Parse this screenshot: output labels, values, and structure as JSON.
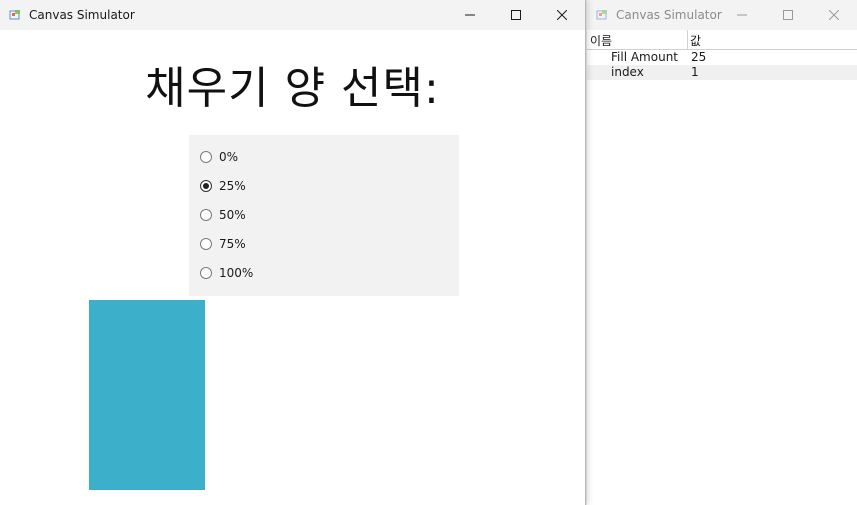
{
  "main_window": {
    "title": "Canvas Simulator",
    "heading": "채우기 양 선택:",
    "radio_options": [
      {
        "label": "0%",
        "checked": false
      },
      {
        "label": "25%",
        "checked": true
      },
      {
        "label": "50%",
        "checked": false
      },
      {
        "label": "75%",
        "checked": false
      },
      {
        "label": "100%",
        "checked": false
      }
    ],
    "fill_color": "#3cafcb",
    "fill_amount_percent": 25
  },
  "side_window": {
    "title": "Canvas Simulator",
    "columns": {
      "name": "이름",
      "value": "값"
    },
    "rows": [
      {
        "name": "Fill Amount",
        "value": "25"
      },
      {
        "name": "index",
        "value": "1"
      }
    ]
  }
}
